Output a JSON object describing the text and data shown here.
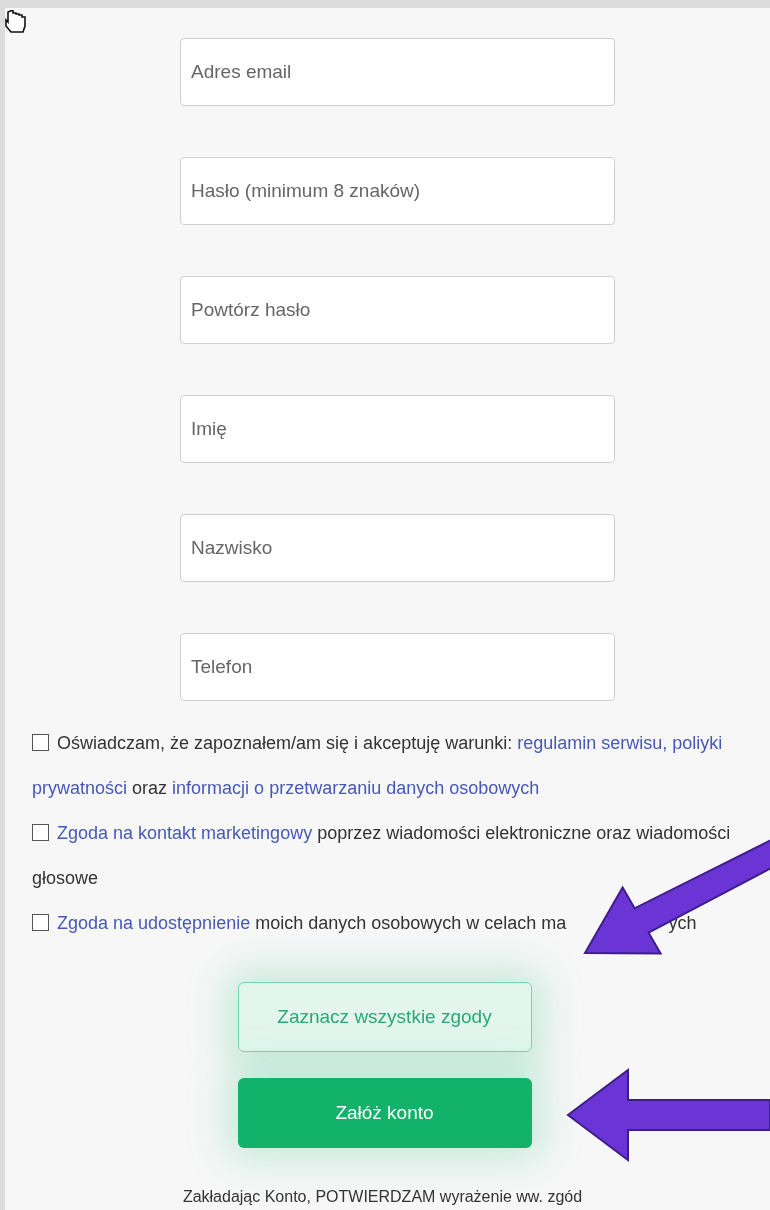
{
  "fields": [
    {
      "placeholder": "Adres email"
    },
    {
      "placeholder": "Hasło (minimum 8 znaków)"
    },
    {
      "placeholder": "Powtórz hasło"
    },
    {
      "placeholder": "Imię"
    },
    {
      "placeholder": "Nazwisko"
    },
    {
      "placeholder": "Telefon"
    }
  ],
  "consents": [
    {
      "checked": false,
      "segments": [
        {
          "text": "Oświadczam, że zapoznałem/am się i akceptuję warunki:",
          "kind": "plain"
        },
        {
          "text": "regulamin serwisu, poliyki",
          "kind": "link"
        },
        {
          "text": "prywatności",
          "kind": "link"
        },
        {
          "text": "oraz",
          "kind": "plain"
        },
        {
          "text": "informacji o przetwarzaniu danych osobowych",
          "kind": "link"
        }
      ]
    },
    {
      "checked": false,
      "segments": [
        {
          "text": "Zgoda na kontakt marketingowy",
          "kind": "link"
        },
        {
          "text": "poprzez wiadomości elektroniczne oraz wiadomości",
          "kind": "plain"
        },
        {
          "text": "głosowe",
          "kind": "plain"
        }
      ]
    },
    {
      "checked": false,
      "segments": [
        {
          "text": "Zgoda na udostępnienie",
          "kind": "link"
        },
        {
          "text": "moich danych osobowych w celach ma",
          "kind": "plain"
        },
        {
          "kind": "covered"
        },
        {
          "text": "ych",
          "kind": "plain"
        }
      ]
    }
  ],
  "buttons": [
    {
      "label": "Zaznacz wszystkie zgody",
      "kind": "outline"
    },
    {
      "label": "Załóż konto",
      "kind": "primary"
    }
  ],
  "footer_note": "Zakładając Konto, POTWIERDZAM wyrażenie ww. zgód"
}
